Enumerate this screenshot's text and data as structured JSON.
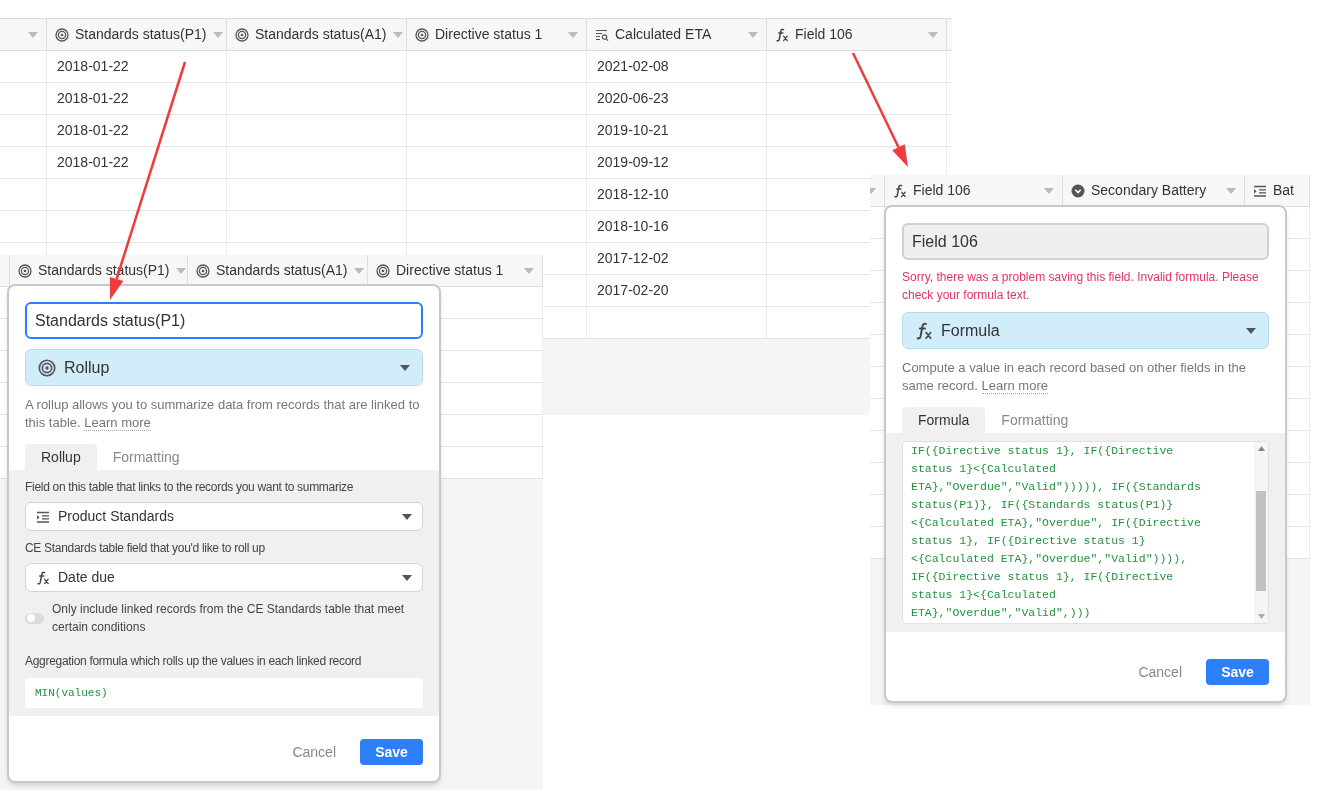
{
  "top_table": {
    "columns": [
      {
        "label": "Standards status(P1)",
        "kind": "rollup"
      },
      {
        "label": "Standards status(A1)",
        "kind": "rollup"
      },
      {
        "label": "Directive status 1",
        "kind": "rollup"
      },
      {
        "label": "Calculated ETA",
        "kind": "lookup"
      },
      {
        "label": "Field 106",
        "kind": "formula"
      }
    ],
    "rows": [
      {
        "standards_status_p1": "2018-01-22",
        "calculated_eta": "2021-02-08"
      },
      {
        "standards_status_p1": "2018-01-22",
        "calculated_eta": "2020-06-23"
      },
      {
        "standards_status_p1": "2018-01-22",
        "calculated_eta": "2019-10-21"
      },
      {
        "standards_status_p1": "2018-01-22",
        "calculated_eta": "2019-09-12"
      },
      {
        "calculated_eta": "2018-12-10"
      },
      {
        "calculated_eta": "2018-10-16"
      },
      {
        "calculated_eta": "2017-12-02"
      },
      {
        "calculated_eta": "2017-02-20"
      }
    ]
  },
  "rollup_view": {
    "columns": [
      {
        "label": "Standards status(P1)",
        "kind": "rollup"
      },
      {
        "label": "Standards status(A1)",
        "kind": "rollup"
      },
      {
        "label": "Directive status 1",
        "kind": "rollup"
      }
    ],
    "dialog": {
      "kind": "rollup",
      "name": "Standards status(P1)",
      "focused": true,
      "type": {
        "label": "Rollup",
        "kind": "rollup"
      },
      "description": "A rollup allows you to summarize data from records that are linked to this table.",
      "learn_more": "Learn more",
      "tabs": [
        {
          "label": "Rollup",
          "selected": true
        },
        {
          "label": "Formatting",
          "selected": false
        }
      ],
      "link_label": "Field on this table that links to the records you want to summarize",
      "link_select": {
        "label": "Product Standards",
        "kind": "link"
      },
      "field_label": "CE Standards table field that you'd like to roll up",
      "field_select": {
        "label": "Date due",
        "kind": "formula"
      },
      "condition": {
        "label": "Only include linked records from the CE Standards table that meet certain conditions",
        "on": false
      },
      "aggregation_label": "Aggregation formula which rolls up the values in each linked record",
      "aggregation": "MIN(values)",
      "cancel": "Cancel",
      "save": "Save"
    }
  },
  "formula_view": {
    "columns": [
      {
        "label": "Field 106",
        "kind": "formula"
      },
      {
        "label": "Secondary Battery",
        "kind": "single_select"
      },
      {
        "label": "Bat",
        "kind": "link"
      }
    ],
    "dialog": {
      "kind": "formula",
      "name": "Field 106",
      "focused": false,
      "error": "Sorry, there was a problem saving this field. Invalid formula. Please check your formula text.",
      "type": {
        "label": "Formula",
        "kind": "formula"
      },
      "description": "Compute a value in each record based on other fields in the same record.",
      "learn_more": "Learn more",
      "tabs": [
        {
          "label": "Formula",
          "selected": true
        },
        {
          "label": "Formatting",
          "selected": false
        }
      ],
      "formula_lines": [
        "IF({Directive status 1}, IF({Directive",
        "status 1}<{Calculated",
        "ETA},\"Overdue\",\"Valid\"))))), IF({Standards",
        "status(P1)}, IF({Standards status(P1)}",
        "<{Calculated ETA},\"Overdue\", IF({Directive",
        "status 1}, IF({Directive status 1}",
        "<{Calculated ETA},\"Overdue\",\"Valid\")))),",
        "IF({Directive status 1}, IF({Directive",
        "status 1}<{Calculated",
        "ETA},\"Overdue\",\"Valid\",)))"
      ],
      "cancel": "Cancel",
      "save": "Save"
    }
  }
}
